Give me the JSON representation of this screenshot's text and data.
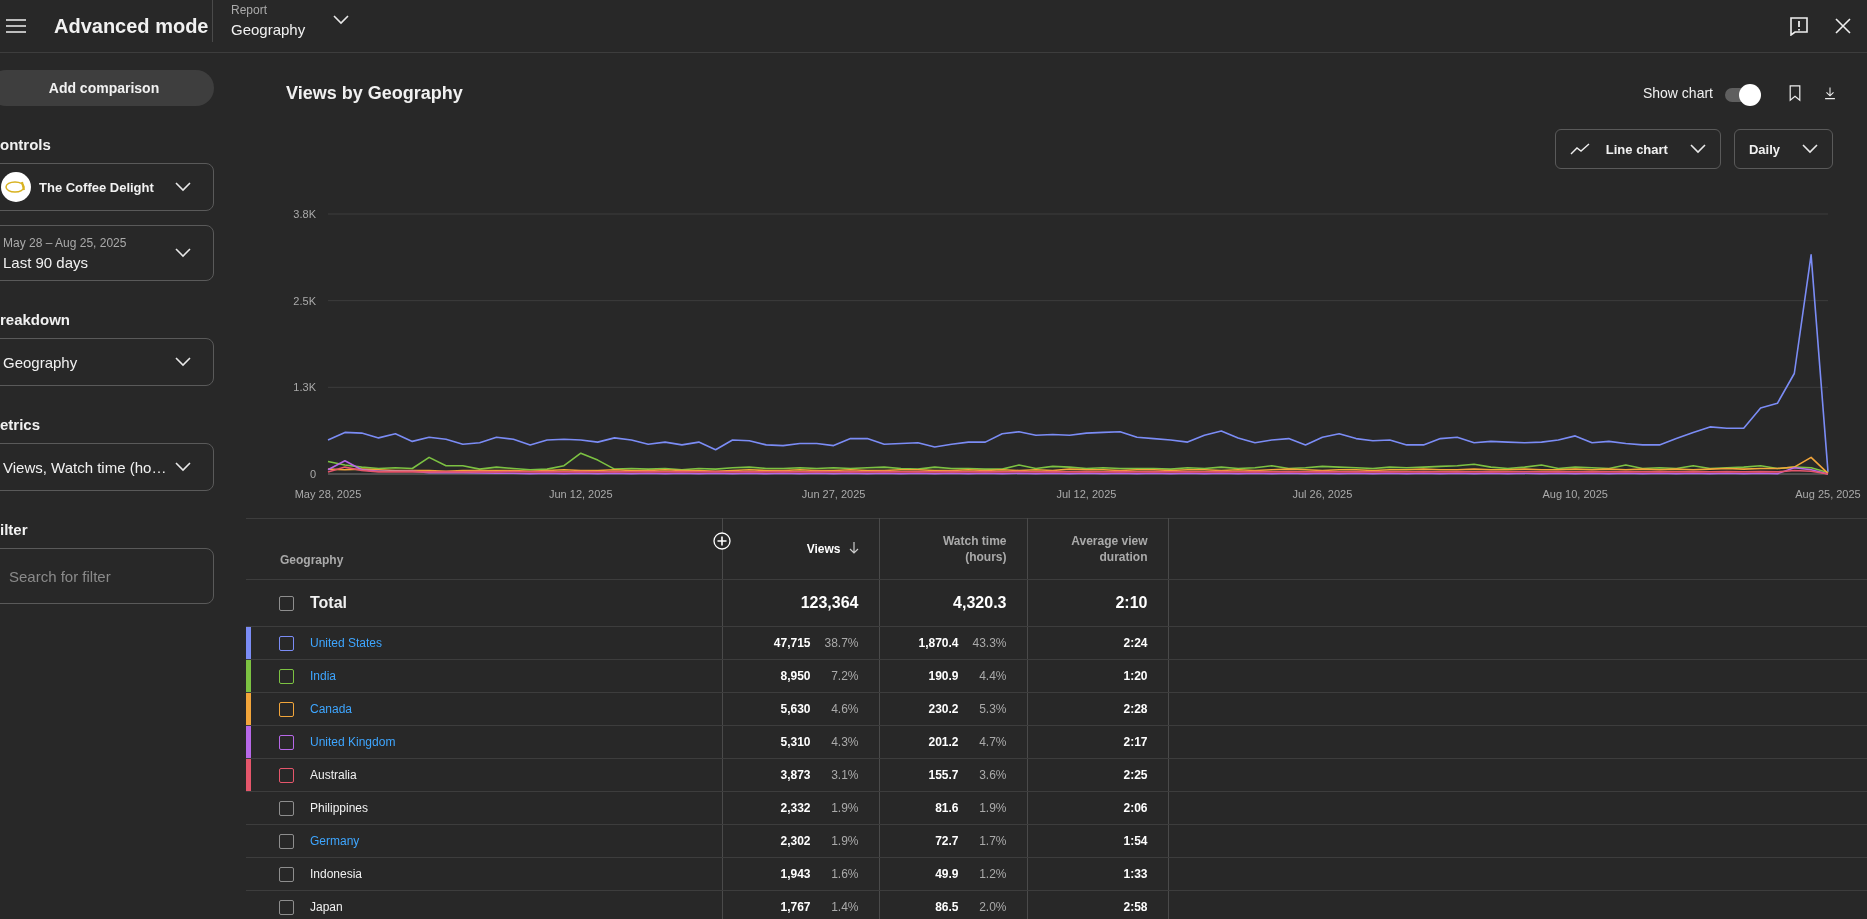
{
  "header": {
    "title": "Advanced mode",
    "report": {
      "label": "Report",
      "value": "Geography"
    }
  },
  "sidebar": {
    "add_comparison": "Add comparison",
    "sections": [
      {
        "heading": "ontrols",
        "fields": [
          {
            "kind": "channel",
            "value": "The Coffee Delight"
          },
          {
            "kind": "date",
            "caption": "May 28 – Aug 25, 2025",
            "value": "Last 90 days"
          }
        ]
      },
      {
        "heading": "reakdown",
        "fields": [
          {
            "kind": "select",
            "value": "Geography"
          }
        ]
      },
      {
        "heading": "etrics",
        "fields": [
          {
            "kind": "select",
            "value": "Views, Watch time (ho…"
          }
        ]
      },
      {
        "heading": "ilter",
        "fields": [
          {
            "kind": "search",
            "placeholder": "Search for filter"
          }
        ]
      }
    ]
  },
  "chart_panel": {
    "title": "Views by Geography",
    "show_chart": {
      "label": "Show chart",
      "on": true
    },
    "chart_type": "Line chart",
    "interval": "Daily",
    "chart_data": {
      "type": "line",
      "categories": [
        "May 28, 2025",
        null,
        null,
        null,
        null,
        null,
        null,
        null,
        null,
        null,
        null,
        null,
        null,
        null,
        null,
        "Jun 12, 2025",
        null,
        null,
        null,
        null,
        null,
        null,
        null,
        null,
        null,
        null,
        null,
        null,
        null,
        null,
        "Jun 27, 2025",
        null,
        null,
        null,
        null,
        null,
        null,
        null,
        null,
        null,
        null,
        null,
        null,
        null,
        null,
        "Jul 12, 2025",
        null,
        null,
        null,
        null,
        null,
        null,
        null,
        null,
        null,
        null,
        null,
        null,
        null,
        "Jul 26, 2025",
        null,
        null,
        null,
        null,
        null,
        null,
        null,
        null,
        null,
        null,
        null,
        null,
        null,
        null,
        "Aug 10, 2025",
        null,
        null,
        null,
        null,
        null,
        null,
        null,
        null,
        null,
        null,
        null,
        null,
        null,
        null,
        "Aug 25, 2025"
      ],
      "yticks": [
        {
          "value": 0,
          "label": "0"
        },
        {
          "value": 1250,
          "label": "1.3K"
        },
        {
          "value": 2500,
          "label": "2.5K"
        },
        {
          "value": 3750,
          "label": "3.8K"
        }
      ],
      "ylim": [
        0,
        3750
      ],
      "series": [
        {
          "color": "#7b8cf5",
          "values": [
            490,
            600,
            590,
            520,
            580,
            470,
            530,
            500,
            430,
            450,
            530,
            500,
            420,
            490,
            500,
            490,
            460,
            520,
            490,
            430,
            460,
            420,
            460,
            350,
            490,
            480,
            420,
            410,
            440,
            440,
            410,
            510,
            510,
            430,
            440,
            450,
            390,
            430,
            460,
            460,
            580,
            610,
            560,
            570,
            560,
            590,
            600,
            610,
            530,
            510,
            490,
            460,
            560,
            620,
            520,
            450,
            490,
            510,
            420,
            530,
            580,
            510,
            480,
            490,
            420,
            420,
            510,
            530,
            450,
            470,
            460,
            450,
            460,
            490,
            550,
            450,
            470,
            440,
            420,
            420,
            510,
            600,
            680,
            660,
            660,
            950,
            1020,
            1450,
            3160,
            30
          ]
        },
        {
          "color": "#7cc242",
          "values": [
            180,
            130,
            100,
            80,
            90,
            80,
            240,
            120,
            120,
            70,
            100,
            80,
            60,
            70,
            120,
            300,
            200,
            70,
            80,
            70,
            80,
            60,
            80,
            70,
            90,
            100,
            80,
            80,
            90,
            80,
            90,
            80,
            90,
            100,
            80,
            70,
            100,
            80,
            80,
            70,
            70,
            130,
            80,
            110,
            100,
            80,
            90,
            80,
            80,
            80,
            70,
            90,
            80,
            100,
            80,
            90,
            120,
            80,
            90,
            110,
            100,
            90,
            80,
            100,
            90,
            100,
            110,
            120,
            140,
            100,
            80,
            100,
            130,
            80,
            100,
            90,
            80,
            130,
            80,
            90,
            80,
            120,
            80,
            90,
            100,
            120,
            80,
            100,
            90,
            20
          ]
        },
        {
          "color": "#f2a53a",
          "values": [
            70,
            60,
            70,
            60,
            50,
            50,
            50,
            40,
            50,
            50,
            50,
            50,
            40,
            50,
            60,
            50,
            50,
            60,
            50,
            50,
            60,
            50,
            50,
            40,
            50,
            60,
            50,
            50,
            60,
            50,
            50,
            60,
            50,
            50,
            60,
            60,
            50,
            50,
            60,
            50,
            60,
            50,
            60,
            50,
            70,
            60,
            60,
            50,
            60,
            60,
            50,
            60,
            60,
            50,
            60,
            50,
            60,
            70,
            60,
            50,
            60,
            60,
            50,
            60,
            60,
            70,
            60,
            60,
            70,
            60,
            60,
            70,
            60,
            60,
            70,
            60,
            70,
            60,
            70,
            60,
            70,
            60,
            70,
            80,
            70,
            80,
            80,
            100,
            240,
            10
          ]
        },
        {
          "color": "#b768e8",
          "values": [
            60,
            190,
            60,
            40,
            40,
            40,
            20,
            20,
            20,
            15,
            10,
            10,
            5,
            10,
            5,
            10,
            5,
            10,
            5,
            10,
            5,
            10,
            5,
            10,
            5,
            10,
            5,
            10,
            5,
            10,
            5,
            10,
            5,
            10,
            5,
            10,
            5,
            10,
            5,
            10,
            5,
            10,
            5,
            10,
            5,
            10,
            5,
            10,
            5,
            10,
            5,
            10,
            5,
            10,
            5,
            10,
            5,
            10,
            5,
            10,
            5,
            10,
            5,
            10,
            5,
            10,
            5,
            10,
            5,
            10,
            5,
            10,
            5,
            10,
            5,
            10,
            5,
            10,
            5,
            10,
            5,
            10,
            5,
            10,
            5,
            10,
            5,
            90,
            60,
            0
          ]
        },
        {
          "color": "#e5566b",
          "values": [
            30,
            100,
            50,
            30,
            30,
            35,
            30,
            35,
            30,
            35,
            30,
            35,
            30,
            35,
            30,
            35,
            30,
            35,
            30,
            35,
            30,
            35,
            30,
            35,
            30,
            35,
            30,
            35,
            30,
            35,
            30,
            35,
            30,
            35,
            30,
            35,
            30,
            35,
            30,
            35,
            30,
            35,
            30,
            35,
            30,
            35,
            30,
            35,
            30,
            35,
            30,
            35,
            30,
            35,
            30,
            35,
            30,
            35,
            30,
            35,
            30,
            35,
            30,
            35,
            30,
            35,
            30,
            35,
            30,
            35,
            30,
            35,
            30,
            35,
            30,
            35,
            30,
            35,
            30,
            35,
            30,
            35,
            30,
            35,
            30,
            35,
            30,
            50,
            40,
            0
          ]
        }
      ]
    }
  },
  "table": {
    "columns": [
      {
        "label": "Geography",
        "sorted": false
      },
      {
        "label": "Views",
        "sorted": true
      },
      {
        "label": "Watch time (hours)",
        "sorted": false
      },
      {
        "label": "Average view duration",
        "sorted": false
      }
    ],
    "total": {
      "label": "Total",
      "checked": false,
      "views": "123,364",
      "watch_time": "4,320.3",
      "avg_duration": "2:10"
    },
    "rows": [
      {
        "name": "United States",
        "checked": false,
        "linked": true,
        "color": "#7b8cf5",
        "views": "47,715",
        "views_share": "38.7%",
        "watch_time": "1,870.4",
        "watch_share": "43.3%",
        "avg_duration": "2:24"
      },
      {
        "name": "India",
        "checked": false,
        "linked": true,
        "color": "#7cc242",
        "views": "8,950",
        "views_share": "7.2%",
        "watch_time": "190.9",
        "watch_share": "4.4%",
        "avg_duration": "1:20"
      },
      {
        "name": "Canada",
        "checked": false,
        "linked": true,
        "color": "#f2a53a",
        "views": "5,630",
        "views_share": "4.6%",
        "watch_time": "230.2",
        "watch_share": "5.3%",
        "avg_duration": "2:28"
      },
      {
        "name": "United Kingdom",
        "checked": false,
        "linked": true,
        "color": "#b768e8",
        "views": "5,310",
        "views_share": "4.3%",
        "watch_time": "201.2",
        "watch_share": "4.7%",
        "avg_duration": "2:17"
      },
      {
        "name": "Australia",
        "checked": false,
        "linked": false,
        "color": "#e5566b",
        "views": "3,873",
        "views_share": "3.1%",
        "watch_time": "155.7",
        "watch_share": "3.6%",
        "avg_duration": "2:25"
      },
      {
        "name": "Philippines",
        "checked": false,
        "linked": false,
        "views": "2,332",
        "views_share": "1.9%",
        "watch_time": "81.6",
        "watch_share": "1.9%",
        "avg_duration": "2:06"
      },
      {
        "name": "Germany",
        "checked": false,
        "linked": true,
        "views": "2,302",
        "views_share": "1.9%",
        "watch_time": "72.7",
        "watch_share": "1.7%",
        "avg_duration": "1:54"
      },
      {
        "name": "Indonesia",
        "checked": false,
        "linked": false,
        "views": "1,943",
        "views_share": "1.6%",
        "watch_time": "49.9",
        "watch_share": "1.2%",
        "avg_duration": "1:33"
      },
      {
        "name": "Japan",
        "checked": false,
        "linked": false,
        "views": "1,767",
        "views_share": "1.4%",
        "watch_time": "86.5",
        "watch_share": "2.0%",
        "avg_duration": "2:58"
      }
    ]
  }
}
